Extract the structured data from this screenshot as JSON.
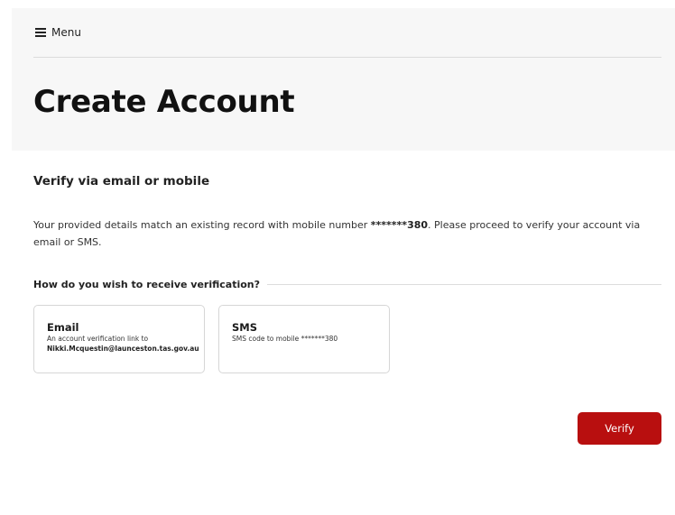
{
  "header": {
    "menu_label": "Menu",
    "title": "Create Account"
  },
  "verify": {
    "section_title": "Verify via email or mobile",
    "info_prefix": "Your provided details match an existing record with mobile number ",
    "masked_mobile": "*******380",
    "info_suffix": ". Please proceed to verify your account via email or SMS.",
    "question": "How do you wish to receive verification?",
    "options": [
      {
        "title": "Email",
        "description": "An account verification link to",
        "detail": "Nikki.Mcquestin@launceston.tas.gov.au"
      },
      {
        "title": "SMS",
        "description": "SMS code to mobile *******380"
      }
    ],
    "submit_label": "Verify"
  },
  "colors": {
    "primary_button": "#b80f0f",
    "hero_background": "#f7f7f7"
  }
}
